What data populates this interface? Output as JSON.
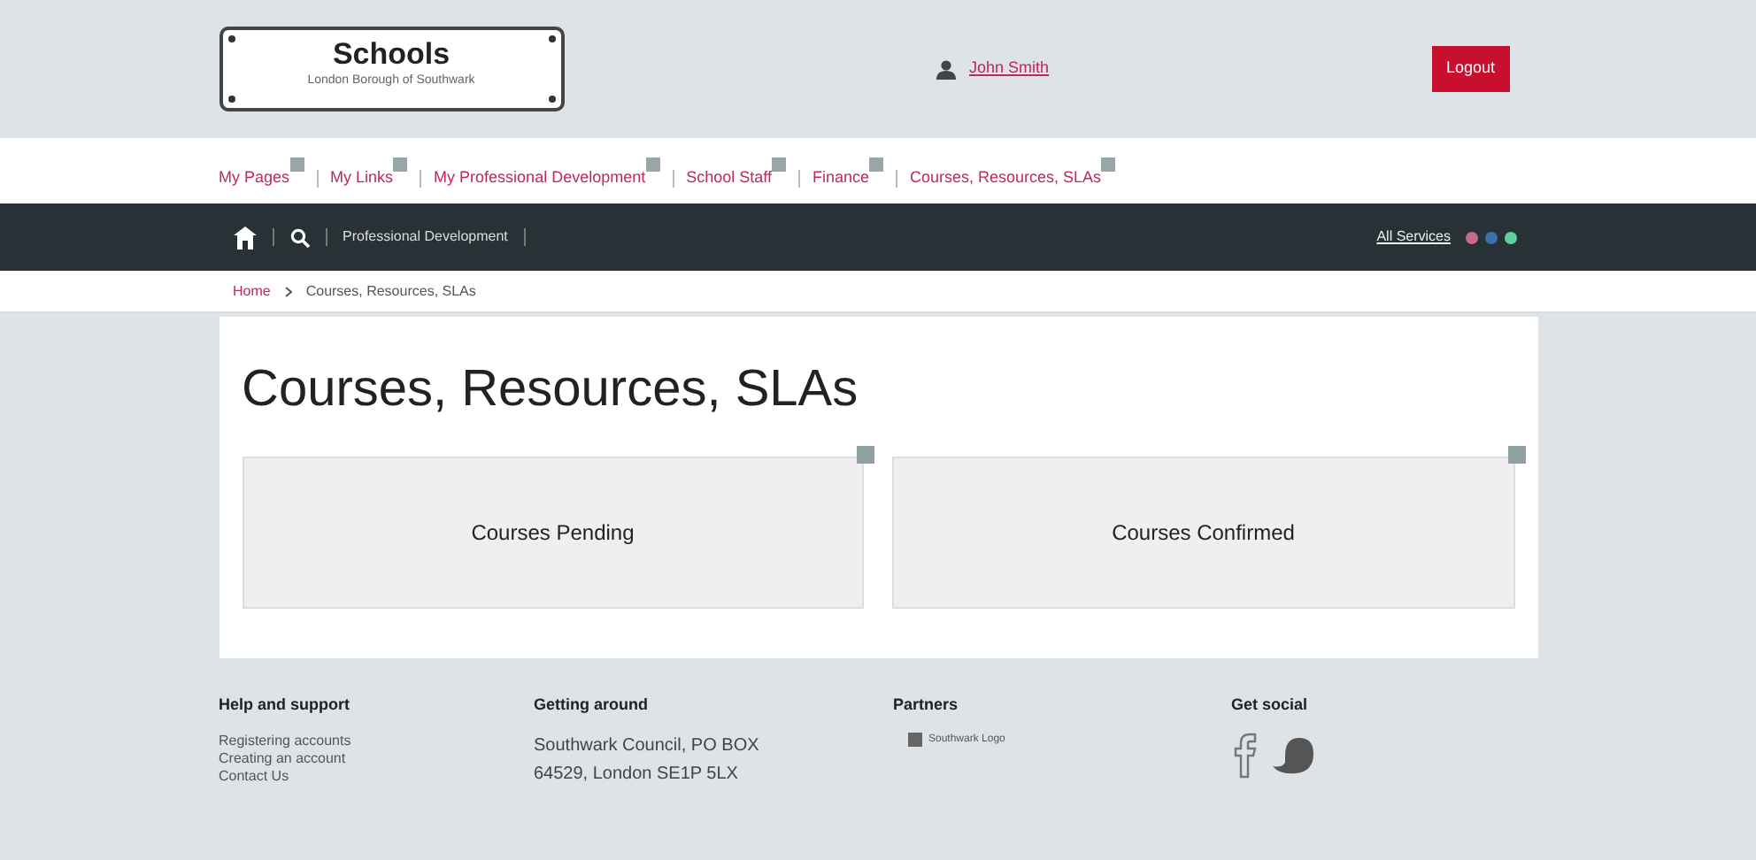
{
  "header": {
    "logo_title": "Schools",
    "logo_subtitle": "London Borough of Southwark",
    "user_name": "John Smith",
    "logout": "Logout"
  },
  "menu": [
    {
      "label": "My Pages"
    },
    {
      "label": "My Links"
    },
    {
      "label": "My Professional Development"
    },
    {
      "label": "School Staff"
    },
    {
      "label": "Finance"
    },
    {
      "label": "Courses, Resources, SLAs"
    }
  ],
  "navbar": {
    "section": "Professional Development",
    "all_services": "All Services",
    "service_dots": [
      {
        "color": "#c76b8a"
      },
      {
        "color": "#3f6fa8"
      },
      {
        "color": "#5fd0a0"
      }
    ]
  },
  "breadcrumb": [
    "Home",
    "Courses, Resources, SLAs"
  ],
  "page_title": "Courses, Resources, SLAs",
  "tiles": [
    {
      "label": "Courses Pending"
    },
    {
      "label": "Courses Confirmed"
    }
  ],
  "footer": [
    {
      "heading": "Help and support",
      "kind": "links",
      "items": [
        "Registering accounts",
        "Creating an account",
        "Contact Us"
      ]
    },
    {
      "heading": "Getting around",
      "kind": "address",
      "items": [
        "Southwark Council, PO BOX",
        "64529, London SE1P 5LX"
      ]
    },
    {
      "heading": "Partners",
      "kind": "partners",
      "items": [
        "Southwark Logo"
      ]
    },
    {
      "heading": "Get social",
      "kind": "social"
    }
  ]
}
